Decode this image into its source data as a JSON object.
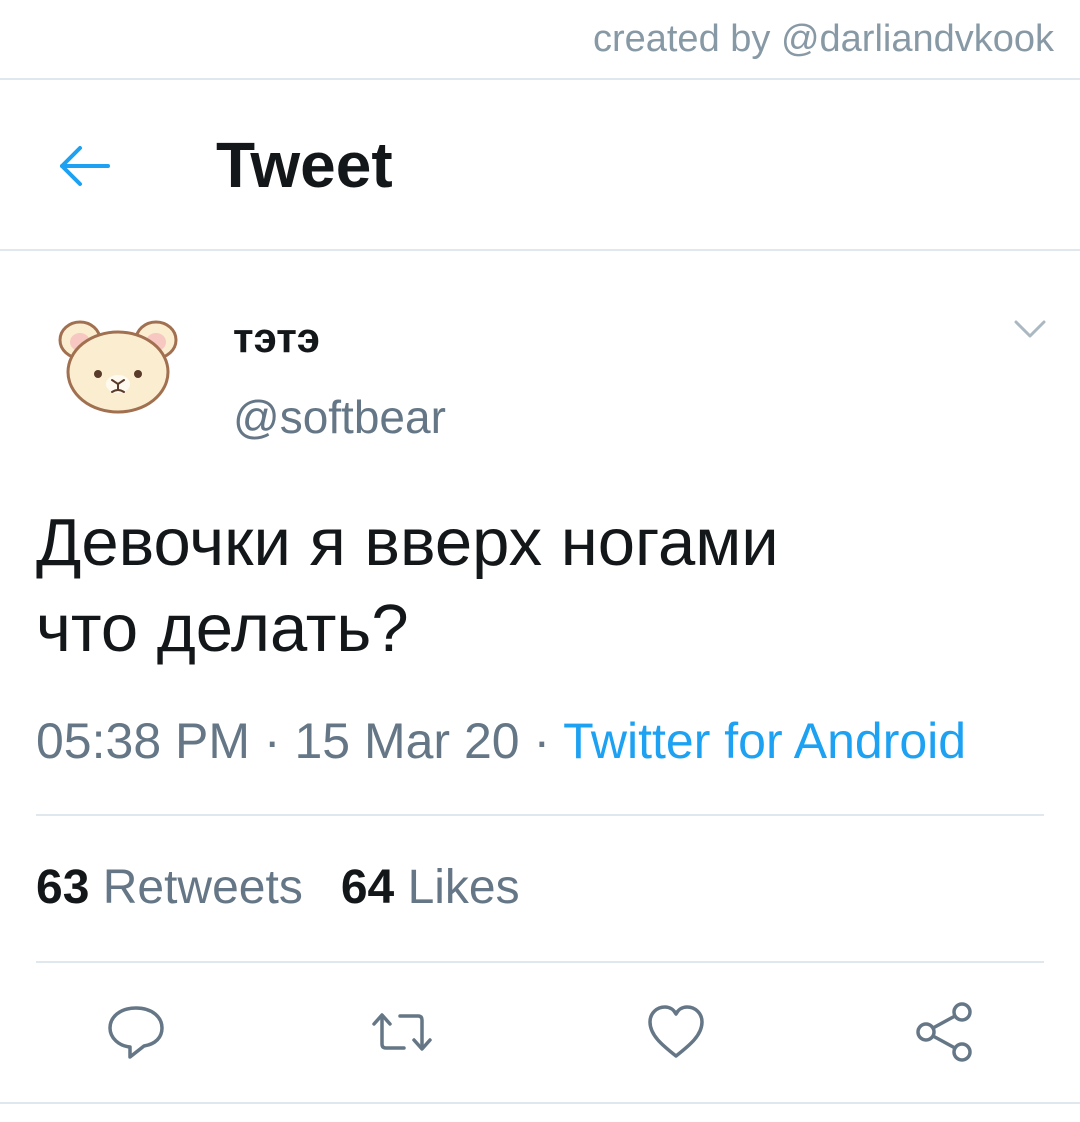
{
  "credit": {
    "text": "created by @darliandvkook"
  },
  "header": {
    "back_icon": "arrow-left-icon",
    "title": "Tweet"
  },
  "tweet": {
    "avatar_icon": "bear-avatar",
    "display_name": "тэтэ",
    "handle": "@softbear",
    "text_lines": [
      "Девочки я вверх ногами",
      "что делать?"
    ],
    "time": "05:38 PM",
    "separator": " · ",
    "date": "15 Mar 20",
    "source": "Twitter for Android",
    "caret_icon": "chevron-down-icon"
  },
  "stats": {
    "retweets_count": "63",
    "retweets_label": "Retweets",
    "likes_count": "64",
    "likes_label": "Likes"
  },
  "actions": [
    {
      "icon": "reply-icon"
    },
    {
      "icon": "retweet-icon"
    },
    {
      "icon": "like-icon"
    },
    {
      "icon": "share-icon"
    }
  ],
  "colors": {
    "accent": "#1da1f2",
    "text": "#14171a",
    "secondary": "#657786",
    "divider": "#e1e8ed"
  }
}
